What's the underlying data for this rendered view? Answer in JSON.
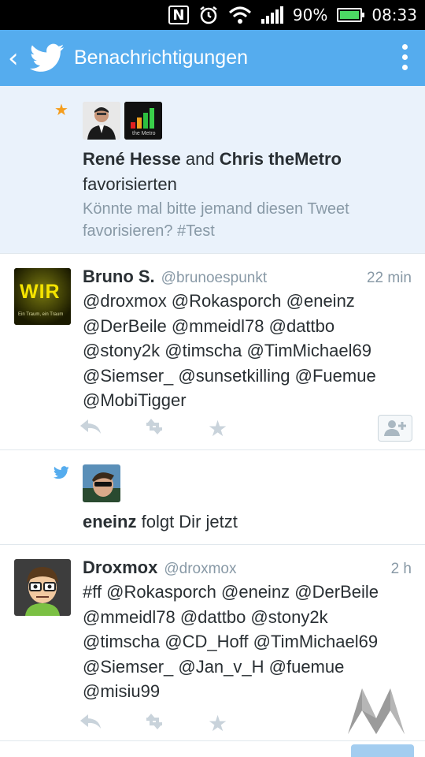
{
  "status_bar": {
    "nfc": "N",
    "battery": "90%",
    "time": "08:33"
  },
  "action_bar": {
    "title": "Benachrichtigungen"
  },
  "notifications": [
    {
      "type": "favorite",
      "users": [
        "René Hesse",
        "Chris theMetro"
      ],
      "connector": "and",
      "action": "favorisierten",
      "tweet_text": "Könnte mal bitte jemand diesen Tweet favorisieren? #Test",
      "avatar2_caption": "the Metro"
    },
    {
      "type": "tweet",
      "name": "Bruno S.",
      "handle": "@brunoespunkt",
      "time": "22 min",
      "avatar_label": "WIR",
      "avatar_caption": "Ein Traum, ein Traum",
      "lines": [
        "@droxmox @Rokasporch @eneinz",
        "@DerBeile @mmeidl78 @dattbo",
        "@stony2k @timscha @TimMichael69",
        "@Siemser_ @sunsetkilling @Fuemue",
        "@MobiTigger"
      ]
    },
    {
      "type": "follow",
      "name": "eneinz",
      "action": "folgt Dir jetzt"
    },
    {
      "type": "tweet",
      "name": "Droxmox",
      "handle": "@droxmox",
      "time": "2 h",
      "lines": [
        "#ff @Rokasporch @eneinz @DerBeile",
        "@mmeidl78 @dattbo @stony2k",
        "@timscha @CD_Hoff @TimMichael69",
        "@Siemser_ @Jan_v_H @fuemue",
        "@misiu99"
      ]
    }
  ],
  "colors": {
    "twitter_blue": "#55acee",
    "favorite_bg": "#eaf2fb",
    "star": "#f59d1c"
  }
}
